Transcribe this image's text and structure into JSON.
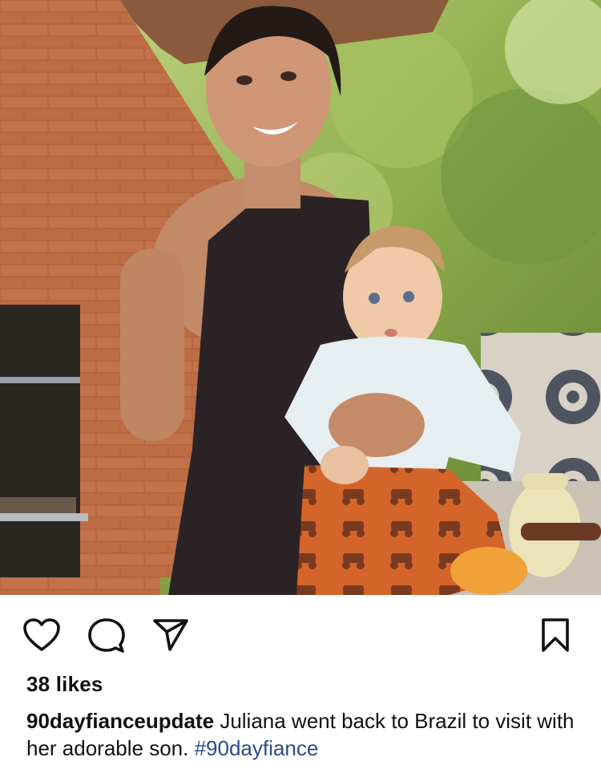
{
  "post": {
    "image": {
      "alt": "post-photo",
      "subject": "woman-holding-baby-in-front-of-brick-oven"
    },
    "actions": {
      "like_icon": "heart-icon",
      "comment_icon": "comment-icon",
      "share_icon": "send-icon",
      "save_icon": "bookmark-icon"
    },
    "likes_text": "38 likes",
    "caption": {
      "username": "90dayfianceupdate",
      "text": " Juliana went back to Brazil to visit with her adorable son. ",
      "hashtag": "#90dayfiance"
    },
    "colors": {
      "text": "#111111",
      "hashtag": "#2a4b8d",
      "background": "#ffffff"
    }
  }
}
